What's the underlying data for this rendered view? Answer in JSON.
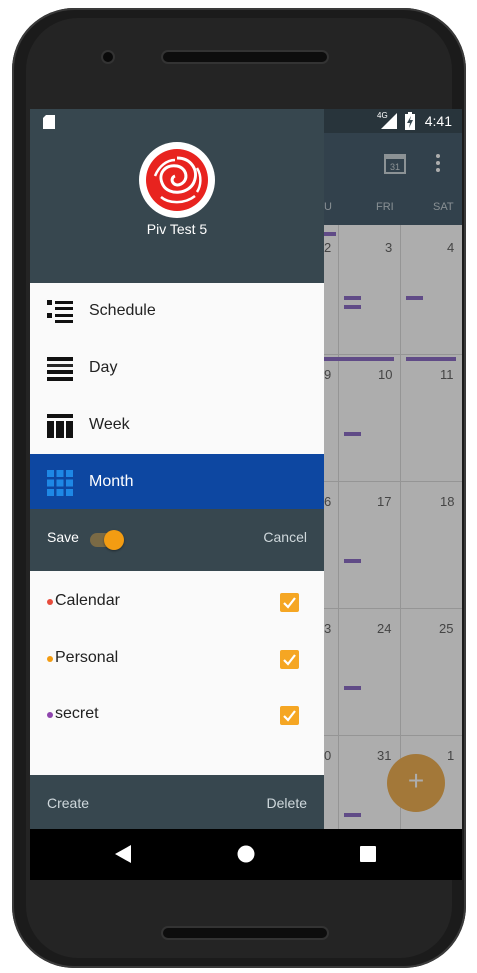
{
  "status_bar": {
    "time": "4:41",
    "network": "4G"
  },
  "calendar": {
    "day_names": [
      "U",
      "FRI",
      "SAT"
    ],
    "weeks": [
      [
        "2",
        "3",
        "4"
      ],
      [
        "9",
        "10",
        "11"
      ],
      [
        "6",
        "17",
        "18"
      ],
      [
        "3",
        "24",
        "25"
      ],
      [
        "0",
        "31",
        "1"
      ]
    ],
    "date_picker_icon": "calendar-today-icon",
    "fab_symbol": "+"
  },
  "drawer": {
    "profile_name": "Piv Test 5",
    "nav_items": [
      {
        "label": "Schedule",
        "icon": "schedule-view-icon"
      },
      {
        "label": "Day",
        "icon": "day-view-icon"
      },
      {
        "label": "Week",
        "icon": "week-view-icon"
      },
      {
        "label": "Month",
        "icon": "month-view-icon",
        "active": true
      }
    ],
    "save_label": "Save",
    "cancel_label": "Cancel",
    "sync_toggle_on": true,
    "calendars": [
      {
        "label": "Calendar",
        "color": "#e74c3c",
        "checked": true
      },
      {
        "label": "Personal",
        "color": "#f39c12",
        "checked": true
      },
      {
        "label": "secret",
        "color": "#8e44ad",
        "checked": true
      }
    ],
    "create_label": "Create",
    "delete_label": "Delete"
  },
  "colors": {
    "accent": "#f39c12",
    "header_dark": "#37474f",
    "active_nav": "#0d47a1"
  }
}
